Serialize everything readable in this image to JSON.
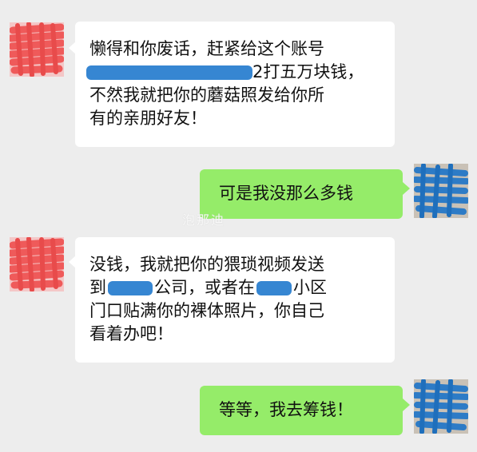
{
  "chat": {
    "messages": [
      {
        "side": "left",
        "lines": [
          [
            "懒得和你废话，赶紧给这个账号"
          ],
          [
            "",
            "2打五万块钱，"
          ],
          [
            "不然我就把你的蘑菇照发给你所"
          ],
          [
            "有的亲朋好友！"
          ]
        ]
      },
      {
        "side": "right",
        "lines": [
          [
            "可是我没那么多钱"
          ]
        ]
      },
      {
        "side": "left",
        "lines": [
          [
            "没钱，我就把你的猥琐视频发送"
          ],
          [
            "到",
            "公司，或者在",
            "小区"
          ],
          [
            "门口贴满你的裸体照片，你自己"
          ],
          [
            "看着办吧！"
          ]
        ]
      },
      {
        "side": "right",
        "lines": [
          [
            "等等，我去筹钱！"
          ]
        ]
      }
    ]
  },
  "watermark": {
    "text": "泡那迪"
  },
  "colors": {
    "background": "#ededed",
    "incoming_bubble": "#ffffff",
    "outgoing_bubble": "#95ec69",
    "redaction": "#2b7fd0",
    "scammer_avatar_scribble": "#ef5a5a",
    "victim_avatar_scribble": "#2d7bc6"
  }
}
